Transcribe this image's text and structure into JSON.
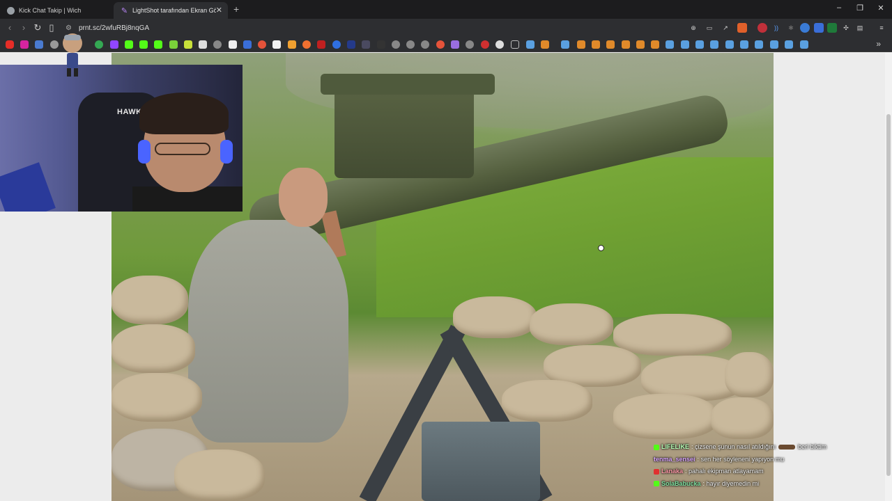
{
  "tabs": [
    {
      "title": "Kick Chat Takip | Wich",
      "active": false
    },
    {
      "title": "LightShot tarafından Ekran Görü",
      "active": true
    }
  ],
  "address_bar": {
    "url": "prnt.sc/2wfuRBj8nqGA"
  },
  "webcam": {
    "chair_logo": "HAWK"
  },
  "chat": [
    {
      "user": "LIFELIKE",
      "user_color": "#b6ffb6",
      "message": "çizsene şunun nasıl atıldığını",
      "suffix": "beri biktim",
      "badge_color": "#53fc18",
      "has_emote": true
    },
    {
      "user": "tenma_sensei",
      "user_color": "#d9a6ff",
      "message": "sen her söyleneni yapıyon mu",
      "badge_color": "",
      "has_emote": false
    },
    {
      "user": "Lanaka",
      "user_color": "#ff9aa8",
      "message": "pahalı ekipman atlayamam",
      "badge_color": "#e03030",
      "has_emote": false
    },
    {
      "user": "SolaBabucka",
      "user_color": "#7ee0a0",
      "message": "hayır diyemedin mi",
      "badge_color": "#53fc18",
      "has_emote": false
    }
  ],
  "colors": {
    "browser_bg": "#1c1c1e",
    "toolbar_bg": "#2d2e31",
    "page_bg": "#ececec",
    "kick_green": "#53fc18"
  }
}
